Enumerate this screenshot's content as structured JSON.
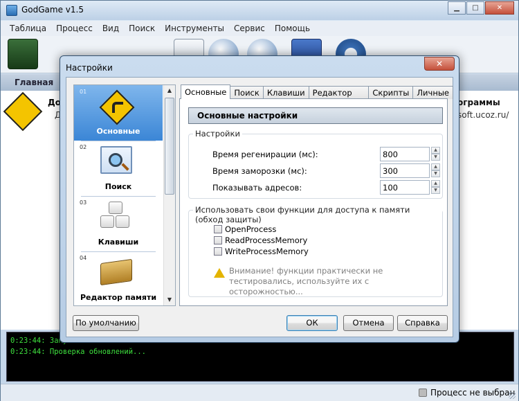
{
  "app": {
    "title": "GodGame v1.5"
  },
  "window_controls": {
    "minimize": "▁",
    "maximize": "□",
    "close": "✕"
  },
  "menu": [
    "Таблица",
    "Процесс",
    "Вид",
    "Поиск",
    "Инструменты",
    "Сервис",
    "Помощь"
  ],
  "mainbar": {
    "label": "Главная"
  },
  "info": {
    "left_title": "До",
    "left_sub": "Д",
    "right_title": "ограммы",
    "right_sub": "soft.ucoz.ru/"
  },
  "console": {
    "lines": [
      {
        "time": "0:23:44",
        "text": ": Запу"
      },
      {
        "time": "0:23:44",
        "text": ": Проверка обновлений..."
      }
    ]
  },
  "status": {
    "text": "Процесс не выбран"
  },
  "dialog": {
    "title": "Настройки",
    "close": "✕",
    "categories": [
      {
        "num": "01",
        "label": "Основные",
        "icon": "road-sign-icon",
        "selected": true
      },
      {
        "num": "02",
        "label": "Поиск",
        "icon": "search-icon",
        "selected": false
      },
      {
        "num": "03",
        "label": "Клавиши",
        "icon": "keyboard-keys-icon",
        "selected": false
      },
      {
        "num": "04",
        "label": "Редактор памяти",
        "icon": "memory-chip-icon",
        "selected": false
      }
    ],
    "tabs": [
      "Основные",
      "Поиск",
      "Клавиши",
      "Редактор памяти",
      "Скрипты",
      "Личные"
    ],
    "active_tab": "Основные",
    "panel": {
      "header": "Основные настройки",
      "settings_group": "Настройки",
      "fields": [
        {
          "label": "Время регенирации (мс):",
          "value": "800"
        },
        {
          "label": "Время заморозки (мс):",
          "value": "300"
        },
        {
          "label": "Показывать адресов:",
          "value": "100"
        }
      ],
      "functions_group": "Использовать свои функции для доступа к памяти (обход защиты)",
      "checkboxes": [
        {
          "label": "OpenProcess",
          "checked": false
        },
        {
          "label": "ReadProcessMemory",
          "checked": false
        },
        {
          "label": "WriteProcessMemory",
          "checked": false
        }
      ],
      "warning": "Внимание! функции практически не тестировались, используйте их с осторожностью..."
    },
    "buttons": {
      "defaults": "По умолчанию",
      "ok": "ОК",
      "cancel": "Отмена",
      "help": "Справка"
    }
  },
  "colors": {
    "console_text": "#3fe23f",
    "selection": "#3b86d6",
    "warning": "#e4b400"
  }
}
